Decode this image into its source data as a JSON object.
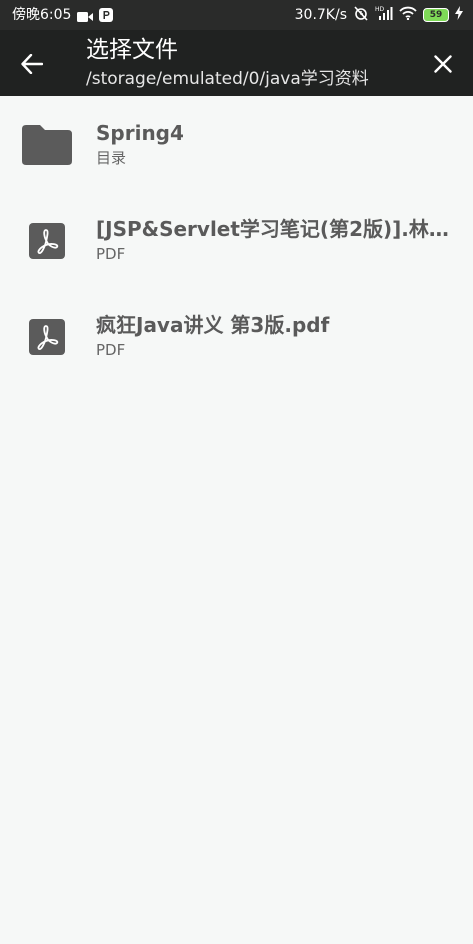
{
  "status_bar": {
    "time": "傍晚6:05",
    "speed": "30.7K/s",
    "battery_level": "59"
  },
  "app_bar": {
    "title": "选择文件",
    "path": "/storage/emulated/0/java学习资料"
  },
  "files": [
    {
      "name": "Spring4",
      "type": "目录",
      "icon": "folder-icon"
    },
    {
      "name": "[JSP&Servlet学习笔记(第2版)].林…",
      "type": "PDF",
      "icon": "pdf-icon"
    },
    {
      "name": "疯狂Java讲义  第3版.pdf",
      "type": "PDF",
      "icon": "pdf-icon"
    }
  ],
  "colors": {
    "app_bar_bg": "#202221",
    "background": "#f6f8f7",
    "icon_gray": "#5b5b5b",
    "battery_green": "#7ed957"
  }
}
